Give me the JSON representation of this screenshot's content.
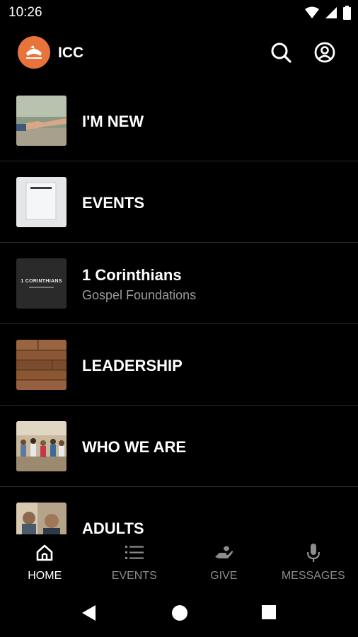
{
  "status_bar": {
    "time": "10:26"
  },
  "header": {
    "app_title": "ICC",
    "search_icon": "search-icon",
    "account_icon": "account-circle-icon"
  },
  "list": [
    {
      "title": "I'M NEW",
      "subtitle": "",
      "thumb": "handshake-photo"
    },
    {
      "title": "EVENTS",
      "subtitle": "",
      "thumb": "white-box-photo"
    },
    {
      "title": "1 Corinthians",
      "subtitle": "Gospel Foundations",
      "thumb": "corinthians-banner",
      "thumb_text": "1 CORINTHIANS"
    },
    {
      "title": "LEADERSHIP",
      "subtitle": "",
      "thumb": "wood-texture"
    },
    {
      "title": "WHO WE ARE",
      "subtitle": "",
      "thumb": "group-photo"
    },
    {
      "title": "ADULTS",
      "subtitle": "",
      "thumb": "adults-photo"
    }
  ],
  "bottom_nav": [
    {
      "label": "HOME",
      "icon": "home-icon",
      "active": true
    },
    {
      "label": "EVENTS",
      "icon": "list-icon",
      "active": false
    },
    {
      "label": "GIVE",
      "icon": "hand-icon",
      "active": false
    },
    {
      "label": "MESSAGES",
      "icon": "microphone-icon",
      "active": false
    }
  ],
  "colors": {
    "background": "#000000",
    "accent": "#e8743b",
    "inactive": "#8d8d8d",
    "divider": "#2b2b2b"
  }
}
